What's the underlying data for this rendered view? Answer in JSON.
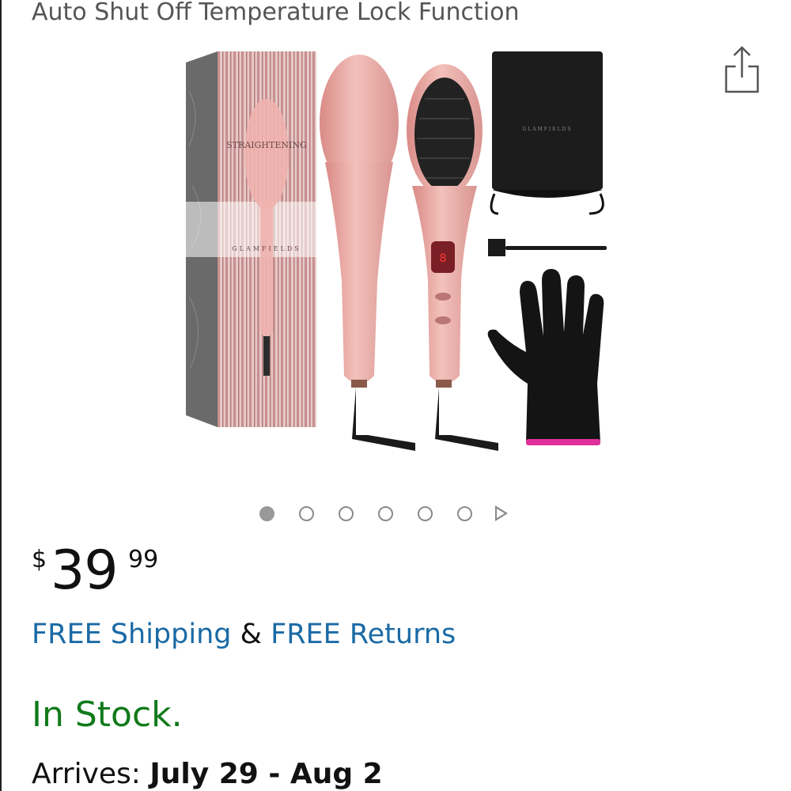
{
  "product": {
    "title": "Auto Shut Off Temperature Lock Function"
  },
  "gallery": {
    "image_label": "Straightening brush set with box, brushes, pouch, cleaning brush and heat glove",
    "box_text": "STRAIGHTENING",
    "brand_text": "GLAMFIELDS",
    "dot_count": 6,
    "active_dot": 0
  },
  "price": {
    "symbol": "$",
    "whole": "39",
    "fraction": "99"
  },
  "shipping": {
    "free_shipping": "FREE Shipping",
    "ampersand": "&",
    "free_returns": "FREE Returns"
  },
  "availability": {
    "status": "In Stock."
  },
  "delivery": {
    "label": "Arrives:",
    "dates": "July 29 - Aug 2"
  },
  "colors": {
    "link": "#1b6aa5",
    "in_stock": "#117a1b",
    "brush_pink": "#e9a6a0"
  },
  "icons": {
    "share": "share-icon",
    "next": "next-arrow-icon"
  }
}
